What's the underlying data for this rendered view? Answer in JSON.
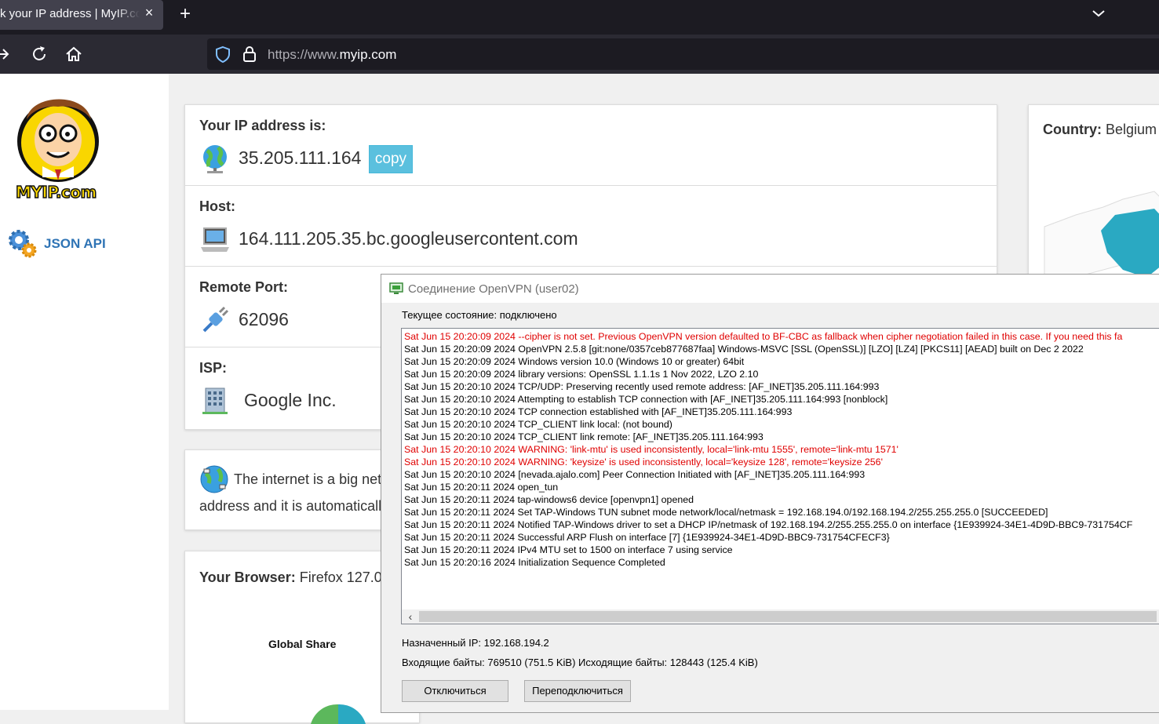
{
  "browser": {
    "tab_title": "k your IP address | MyIP.com",
    "tab_close": "×",
    "new_tab": "+",
    "url_prefix": "https://www.",
    "url_domain": "myip.com"
  },
  "sidebar": {
    "logo_text": "MYIP.com",
    "json_api_label": "JSON API"
  },
  "ip_info": {
    "ip_label": "Your IP address is:",
    "ip_value": "35.205.111.164",
    "copy_label": "copy",
    "host_label": "Host:",
    "host_value": "164.111.205.35.bc.googleusercontent.com",
    "port_label": "Remote Port:",
    "port_value": "62096",
    "isp_label": "ISP:",
    "isp_value": "Google Inc."
  },
  "country": {
    "label": "Country:",
    "value": "Belgium",
    "map_color": "#2aa9c2"
  },
  "internet_card": {
    "line1": "The internet is a big netw",
    "line2": "address and it is automatically"
  },
  "browser_card": {
    "label": "Your Browser:",
    "value": "Firefox 127.0",
    "chart_title": "Global Share"
  },
  "vpn": {
    "title": "Соединение OpenVPN (user02)",
    "status": "Текущее состояние: подключено",
    "log": [
      {
        "text": "Sat Jun 15 20:20:09 2024 --cipher is not set. Previous OpenVPN version defaulted to BF-CBC as fallback when cipher negotiation failed in this case. If you need this fa",
        "error": true
      },
      {
        "text": "Sat Jun 15 20:20:09 2024 OpenVPN 2.5.8 [git:none/0357ceb877687faa] Windows-MSVC [SSL (OpenSSL)] [LZO] [LZ4] [PKCS11] [AEAD] built on Dec  2 2022",
        "error": false
      },
      {
        "text": "Sat Jun 15 20:20:09 2024 Windows version 10.0 (Windows 10 or greater) 64bit",
        "error": false
      },
      {
        "text": "Sat Jun 15 20:20:09 2024 library versions: OpenSSL 1.1.1s  1 Nov 2022, LZO 2.10",
        "error": false
      },
      {
        "text": "Sat Jun 15 20:20:10 2024 TCP/UDP: Preserving recently used remote address: [AF_INET]35.205.111.164:993",
        "error": false
      },
      {
        "text": "Sat Jun 15 20:20:10 2024 Attempting to establish TCP connection with [AF_INET]35.205.111.164:993 [nonblock]",
        "error": false
      },
      {
        "text": "Sat Jun 15 20:20:10 2024 TCP connection established with [AF_INET]35.205.111.164:993",
        "error": false
      },
      {
        "text": "Sat Jun 15 20:20:10 2024 TCP_CLIENT link local: (not bound)",
        "error": false
      },
      {
        "text": "Sat Jun 15 20:20:10 2024 TCP_CLIENT link remote: [AF_INET]35.205.111.164:993",
        "error": false
      },
      {
        "text": "Sat Jun 15 20:20:10 2024 WARNING: 'link-mtu' is used inconsistently, local='link-mtu 1555', remote='link-mtu 1571'",
        "error": true
      },
      {
        "text": "Sat Jun 15 20:20:10 2024 WARNING: 'keysize' is used inconsistently, local='keysize 128', remote='keysize 256'",
        "error": true
      },
      {
        "text": "Sat Jun 15 20:20:10 2024 [nevada.ajalo.com] Peer Connection Initiated with [AF_INET]35.205.111.164:993",
        "error": false
      },
      {
        "text": "Sat Jun 15 20:20:11 2024 open_tun",
        "error": false
      },
      {
        "text": "Sat Jun 15 20:20:11 2024 tap-windows6 device [openvpn1] opened",
        "error": false
      },
      {
        "text": "Sat Jun 15 20:20:11 2024 Set TAP-Windows TUN subnet mode network/local/netmask = 192.168.194.0/192.168.194.2/255.255.255.0 [SUCCEEDED]",
        "error": false
      },
      {
        "text": "Sat Jun 15 20:20:11 2024 Notified TAP-Windows driver to set a DHCP IP/netmask of 192.168.194.2/255.255.255.0 on interface {1E939924-34E1-4D9D-BBC9-731754CF",
        "error": false
      },
      {
        "text": "Sat Jun 15 20:20:11 2024 Successful ARP Flush on interface [7] {1E939924-34E1-4D9D-BBC9-731754CFECF3}",
        "error": false
      },
      {
        "text": "Sat Jun 15 20:20:11 2024 IPv4 MTU set to 1500 on interface 7 using service",
        "error": false
      },
      {
        "text": "Sat Jun 15 20:20:16 2024 Initialization Sequence Completed",
        "error": false
      }
    ],
    "assigned_ip": "Назначенный IP: 192.168.194.2",
    "bytes": "Входящие байты: 769510 (751.5 KiB)  Исходящие байты: 128443 (125.4 KiB)",
    "disconnect_label": "Отключиться",
    "reconnect_label": "Переподключиться",
    "error_color": "#e00000"
  }
}
